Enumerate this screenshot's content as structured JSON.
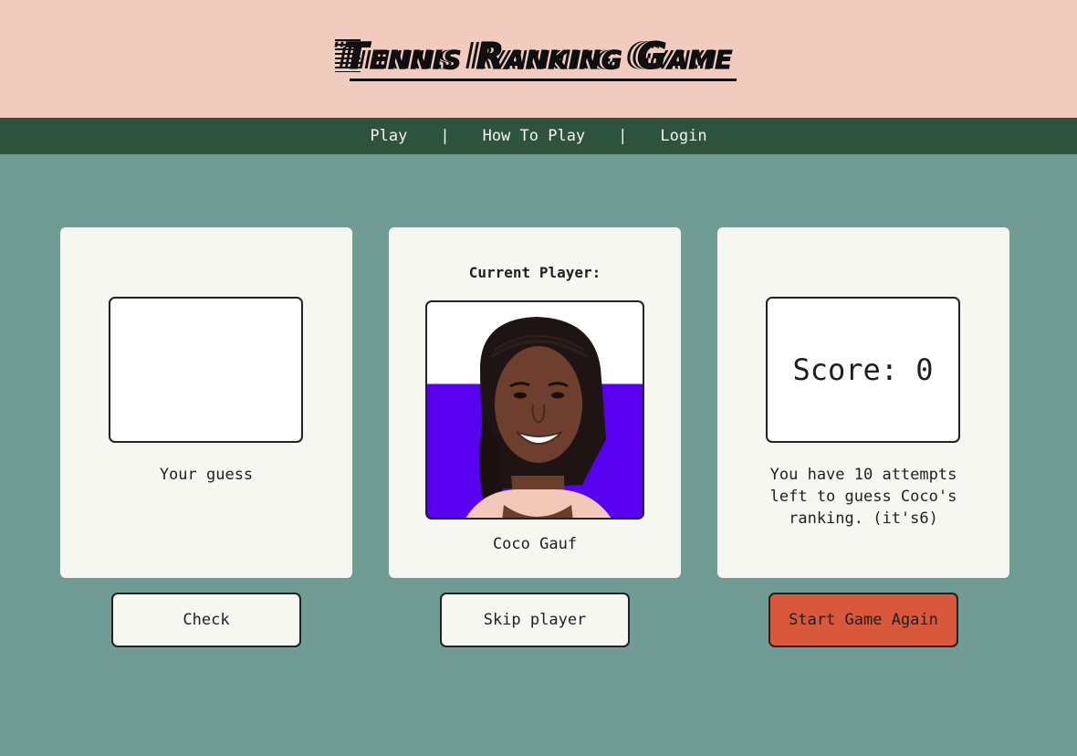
{
  "header": {
    "title": "Tennis Ranking Game"
  },
  "nav": {
    "items": [
      "Play",
      "How To Play",
      "Login"
    ],
    "separator": "|"
  },
  "guess_panel": {
    "input_value": "",
    "caption": "Your guess",
    "check_label": "Check"
  },
  "player_panel": {
    "heading": "Current Player:",
    "player_name": "Coco Gauf",
    "skip_label": "Skip player"
  },
  "score_panel": {
    "score_text": "Score: 0",
    "attempts_text": "You have 10 attempts left to guess Coco's ranking. (it's6)",
    "restart_label": "Start Game Again"
  },
  "colors": {
    "page_bg": "#719c96",
    "header_bg": "#f0cbbe",
    "nav_bg": "#2e533d",
    "card_bg": "#f7f7f2",
    "restart_button": "#d9573a",
    "photo_accent": "#5a00f0"
  }
}
